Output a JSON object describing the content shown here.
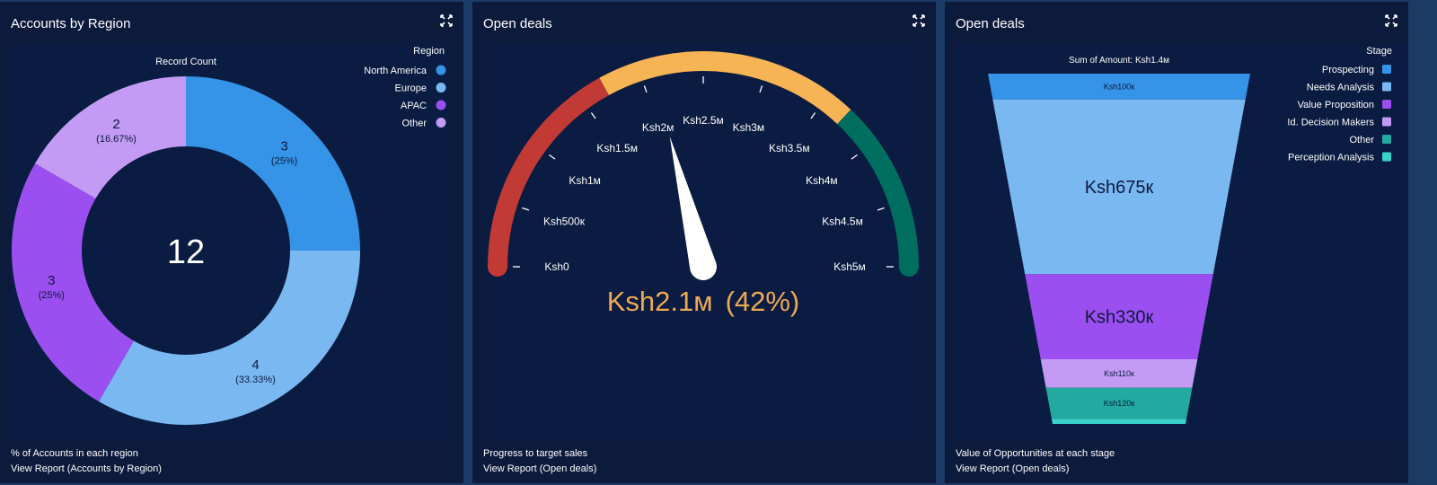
{
  "panels": [
    {
      "title": "Accounts by Region",
      "description": "% of Accounts in each region",
      "link": "View Report (Accounts by Region)",
      "icon": "expand-icon"
    },
    {
      "title": "Open deals",
      "description": "Progress to target sales",
      "link": "View Report (Open deals)",
      "icon": "expand-icon"
    },
    {
      "title": "Open deals",
      "description": "Value of Opportunities at each stage",
      "link": "View Report (Open deals)",
      "icon": "expand-icon"
    }
  ],
  "colors": {
    "blue": "#3594e8",
    "light_blue": "#7ab8f2",
    "purple": "#9b4ff0",
    "lavender": "#c39bf5",
    "teal": "#22a9a0",
    "aqua": "#3ad3cc",
    "red": "#c23a35",
    "amber": "#f6b455",
    "green": "#006e5f",
    "gauge_value": "#f0a954"
  },
  "chart_data": [
    {
      "type": "pie",
      "style": "donut",
      "title": "Record Count",
      "legend_title": "Region",
      "legend_position": "top-right",
      "center_label": "12",
      "slices": [
        {
          "name": "North America",
          "value": 3,
          "label": "3",
          "pct": "(25%)",
          "color": "#3594e8"
        },
        {
          "name": "Europe",
          "value": 4,
          "label": "4",
          "pct": "(33.33%)",
          "color": "#7ab8f2"
        },
        {
          "name": "APAC",
          "value": 3,
          "label": "3",
          "pct": "(25%)",
          "color": "#9b4ff0"
        },
        {
          "name": "Other",
          "value": 2,
          "label": "2",
          "pct": "(16.67%)",
          "color": "#c39bf5"
        }
      ]
    },
    {
      "type": "gauge",
      "min": 0,
      "max": 5000000,
      "value": 2100000,
      "value_label": "Ksh2.1м",
      "pct_label": "(42%)",
      "ticks": [
        {
          "value": 0,
          "label": "Ksh0"
        },
        {
          "value": 500000,
          "label": "Ksh500к"
        },
        {
          "value": 1000000,
          "label": "Ksh1м"
        },
        {
          "value": 1500000,
          "label": "Ksh1.5м"
        },
        {
          "value": 2000000,
          "label": "Ksh2м"
        },
        {
          "value": 2500000,
          "label": "Ksh2.5м"
        },
        {
          "value": 3000000,
          "label": "Ksh3м"
        },
        {
          "value": 3500000,
          "label": "Ksh3.5м"
        },
        {
          "value": 4000000,
          "label": "Ksh4м"
        },
        {
          "value": 4500000,
          "label": "Ksh4.5м"
        },
        {
          "value": 5000000,
          "label": "Ksh5м"
        }
      ],
      "bands": [
        {
          "from": 0,
          "to": 1700000,
          "color": "#c23a35"
        },
        {
          "from": 1700000,
          "to": 3700000,
          "color": "#f6b455"
        },
        {
          "from": 3700000,
          "to": 5000000,
          "color": "#006e5f"
        }
      ]
    },
    {
      "type": "funnel",
      "title": "Sum of Amount: Ksh1.4м",
      "legend_title": "Stage",
      "legend_position": "top-right",
      "stages": [
        {
          "name": "Prospecting",
          "value": 100000,
          "label": "Ksh100к",
          "color": "#3594e8"
        },
        {
          "name": "Needs Analysis",
          "value": 675000,
          "label": "Ksh675к",
          "color": "#7ab8f2"
        },
        {
          "name": "Value Proposition",
          "value": 330000,
          "label": "Ksh330к",
          "color": "#9b4ff0"
        },
        {
          "name": "Id. Decision Makers",
          "value": 110000,
          "label": "Ksh110к",
          "color": "#c39bf5"
        },
        {
          "name": "Other",
          "value": 120000,
          "label": "Ksh120к",
          "color": "#22a9a0"
        },
        {
          "name": "Perception Analysis",
          "value": 20000,
          "label": "",
          "color": "#3ad3cc"
        }
      ]
    }
  ]
}
